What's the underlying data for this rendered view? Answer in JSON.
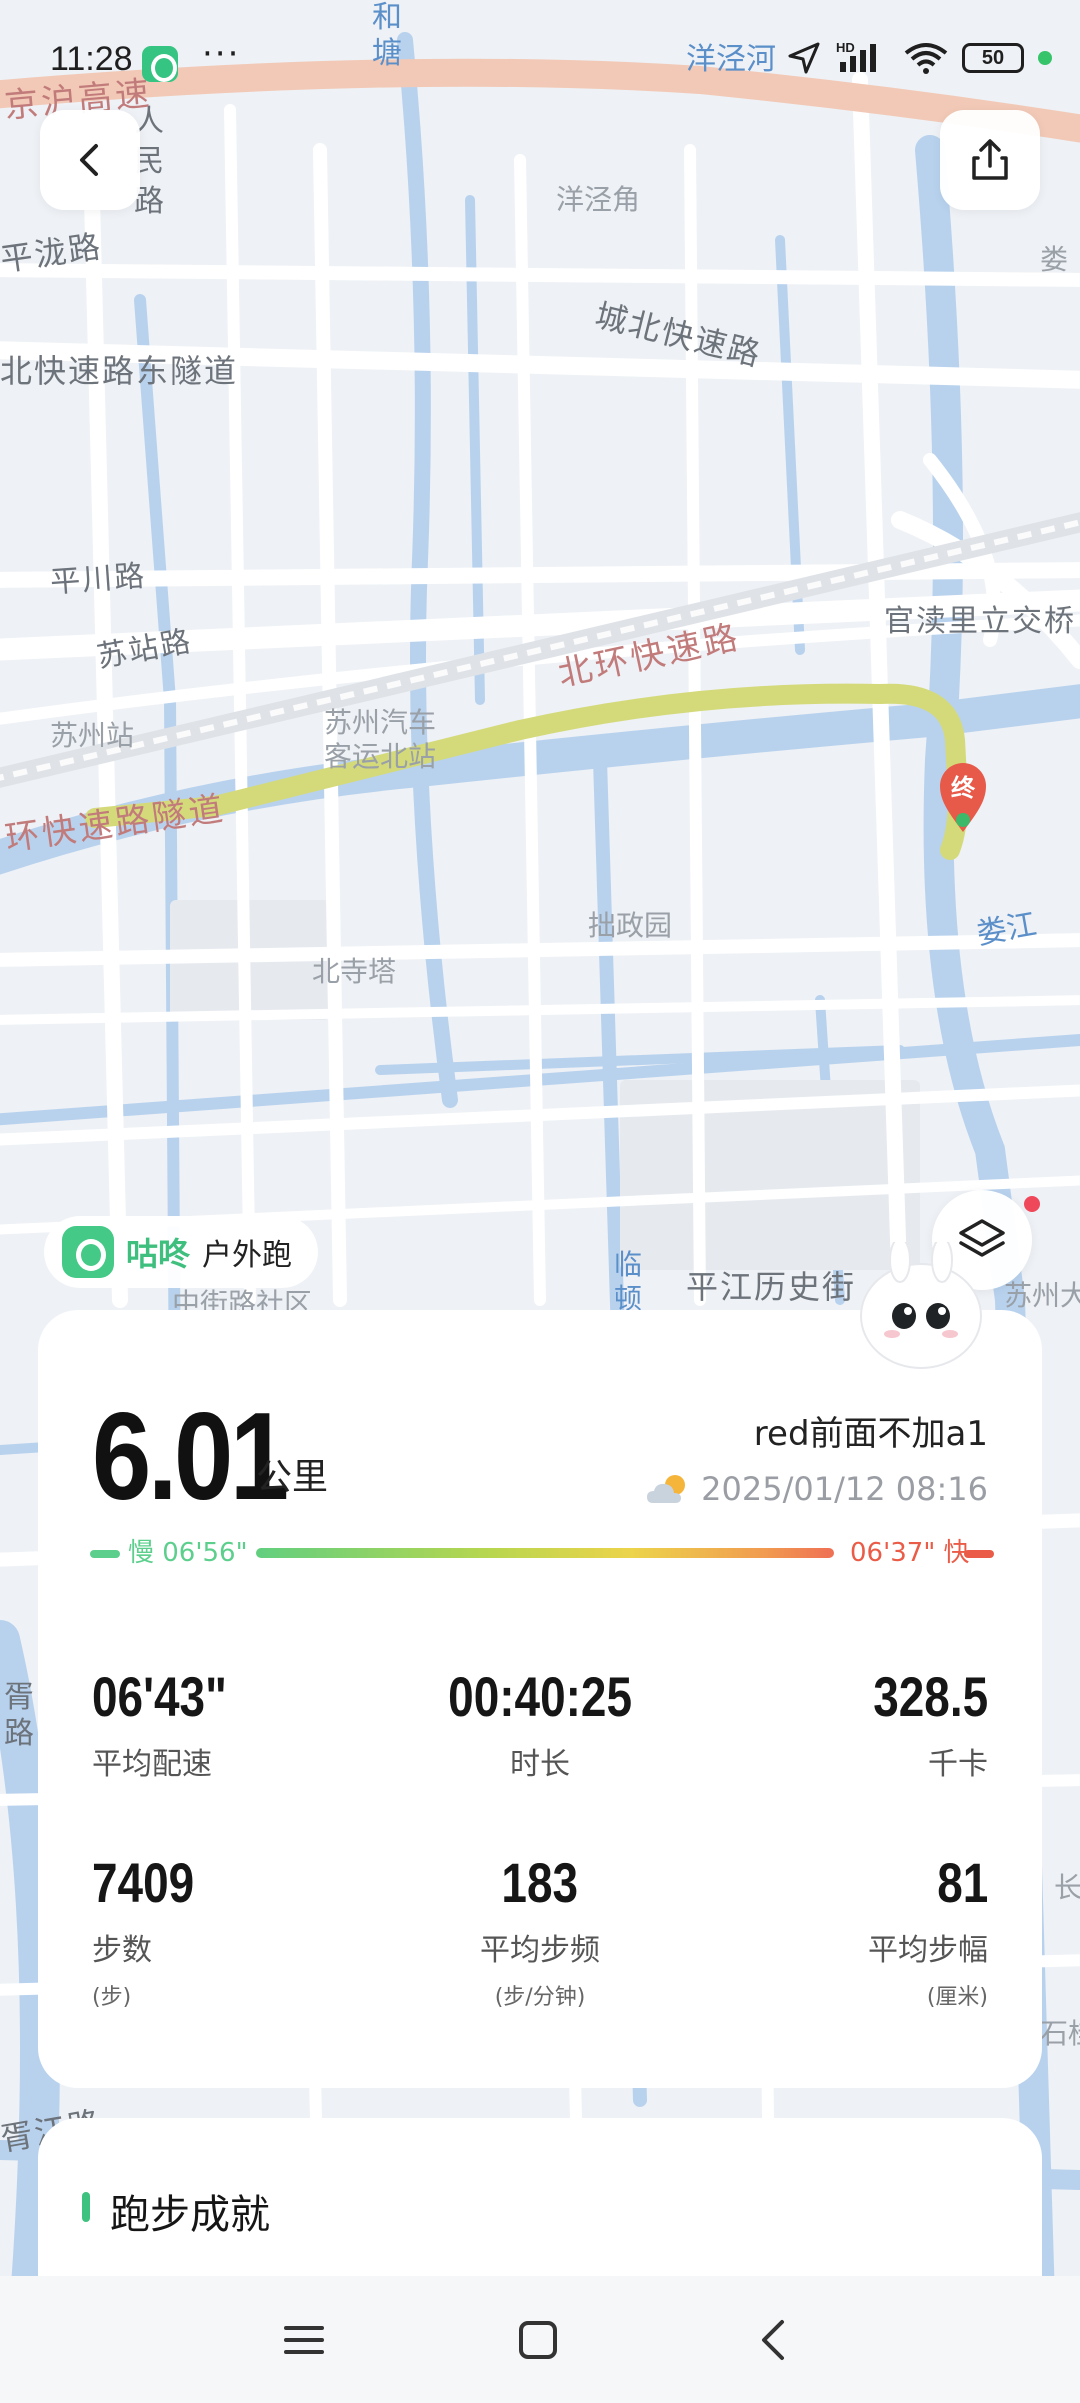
{
  "status_bar": {
    "time": "11:28",
    "battery": "50",
    "network": "HD"
  },
  "map": {
    "labels": {
      "jinghu": "京沪高速",
      "hetang": "和\n塘",
      "renminlu": "人\n民\n路",
      "yangjinghe": "洋泾河",
      "yangjingjiao": "洋泾角",
      "pinglonglu": "平泷路",
      "chengbei": "城北快速路",
      "lou1": "娄",
      "beikuaisuilu": "北快速路东隧道",
      "pingchuan": "平川路",
      "suzhan": "苏站路",
      "beihuan": "北环快速路",
      "guandu": "官渎里立交桥",
      "suzhouzhan": "苏州站",
      "qiche": "苏州汽车\n客运北站",
      "huansuidao": "环快速路隧道",
      "zhuozheng": "拙政园",
      "loujiang": "娄江",
      "beisita": "北寺塔",
      "zhongjie": "中街路社区",
      "linlu": "临\n顿",
      "pingjiang": "平江历史街",
      "suzhouda": "苏州大",
      "xuxu": "胥\n路",
      "xujiang": "胥江路",
      "chang": "长",
      "shigu": "石桂",
      "end_marker": "终"
    },
    "colors": {
      "route": "#d4da7a",
      "water": "#b8d2ee",
      "road": "#ffffff",
      "highway": "#f2c9b6"
    }
  },
  "buttons": {
    "back_icon": "chevron-left-icon",
    "share_icon": "share-icon",
    "layers_icon": "layers-icon"
  },
  "brand": {
    "name": "咕咚",
    "sub": "户外跑"
  },
  "summary": {
    "distance": "6.01",
    "distance_unit": "公里",
    "name": "red前面不加a1",
    "date": "2025/01/12 08:16",
    "weather_icon": "partly-cloudy-icon",
    "pace_slow": "慢 06'56\"",
    "pace_fast": "06'37\" 快",
    "stats": {
      "avg_pace": {
        "value": "06'43\"",
        "label": "平均配速"
      },
      "duration": {
        "value": "00:40:25",
        "label": "时长"
      },
      "calories": {
        "value": "328.5",
        "label": "千卡"
      },
      "steps": {
        "value": "7409",
        "label": "步数",
        "unit": "(步)"
      },
      "cadence": {
        "value": "183",
        "label": "平均步频",
        "unit": "(步/分钟)"
      },
      "stride": {
        "value": "81",
        "label": "平均步幅",
        "unit": "(厘米)"
      }
    }
  },
  "achievements": {
    "title": "跑步成就"
  },
  "navbar": {
    "menu_icon": "menu-icon",
    "home_icon": "home-square-icon",
    "back_icon": "back-chevron-icon"
  }
}
